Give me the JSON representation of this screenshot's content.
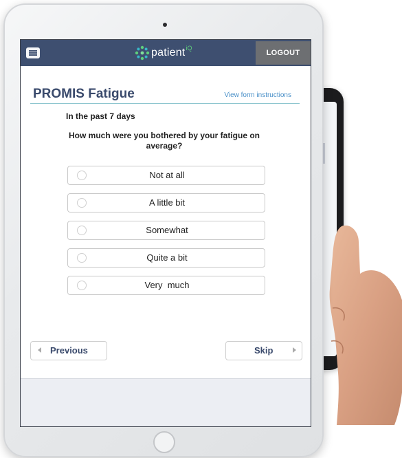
{
  "header": {
    "logo_text": "patient",
    "logo_superscript": "iQ",
    "logout_label": "LOGOUT",
    "brand_color": "#3e4f70",
    "accent_color": "#5fd07c"
  },
  "form": {
    "title": "PROMIS Fatigue",
    "instructions_link": "View form instructions",
    "timeframe": "In the past 7 days",
    "question": "How much were you bothered by your fatigue on average?",
    "options": [
      {
        "label": "Not at all",
        "selected": false
      },
      {
        "label": "A little bit",
        "selected": false
      },
      {
        "label": "Somewhat",
        "selected": false
      },
      {
        "label": "Quite a bit",
        "selected": false
      },
      {
        "label": "Very  much",
        "selected": false
      }
    ]
  },
  "navigation": {
    "previous_label": "Previous",
    "skip_label": "Skip"
  },
  "icons": {
    "menu": "hamburger-menu-icon",
    "logo": "dots-ring-logo-icon",
    "previous": "chevron-left-icon",
    "skip": "chevron-right-icon"
  }
}
